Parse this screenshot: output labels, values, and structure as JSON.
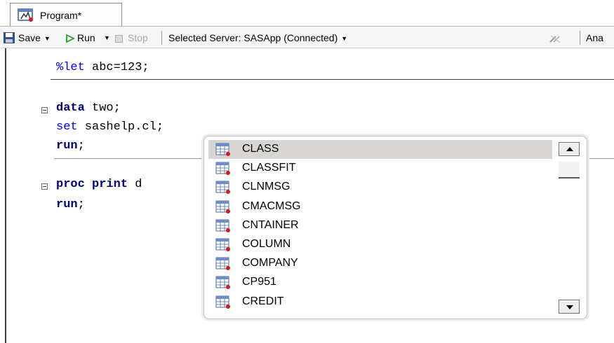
{
  "tab": {
    "label": "Program*",
    "icon": "program-icon"
  },
  "toolbar": {
    "save": "Save",
    "run": "Run",
    "stop": "Stop",
    "server": "Selected Server: SASApp (Connected)",
    "analyze": "Ana"
  },
  "code": {
    "line1": {
      "macro": "%let",
      "text": " abc=123;"
    },
    "line2": {
      "keyword": "data",
      "text": " two;"
    },
    "line3": {
      "keyword": "set",
      "text": " sashelp.cl;"
    },
    "line4": {
      "keyword": "run",
      "text": ";"
    },
    "line5": {
      "keyword": "proc print",
      "text": " d"
    },
    "line6": {
      "keyword": "run",
      "text": ";"
    }
  },
  "autocomplete": {
    "items": [
      "CLASS",
      "CLASSFIT",
      "CLNMSG",
      "CMACMSG",
      "CNTAINER",
      "COLUMN",
      "COMPANY",
      "CP951",
      "CREDIT"
    ],
    "selected_index": 0,
    "item_icon": "dataset-table-icon"
  },
  "colors": {
    "keyword": "#000080",
    "macro": "#0000ff",
    "selection": "#d8d6d3",
    "run_green": "#2aa02a"
  }
}
